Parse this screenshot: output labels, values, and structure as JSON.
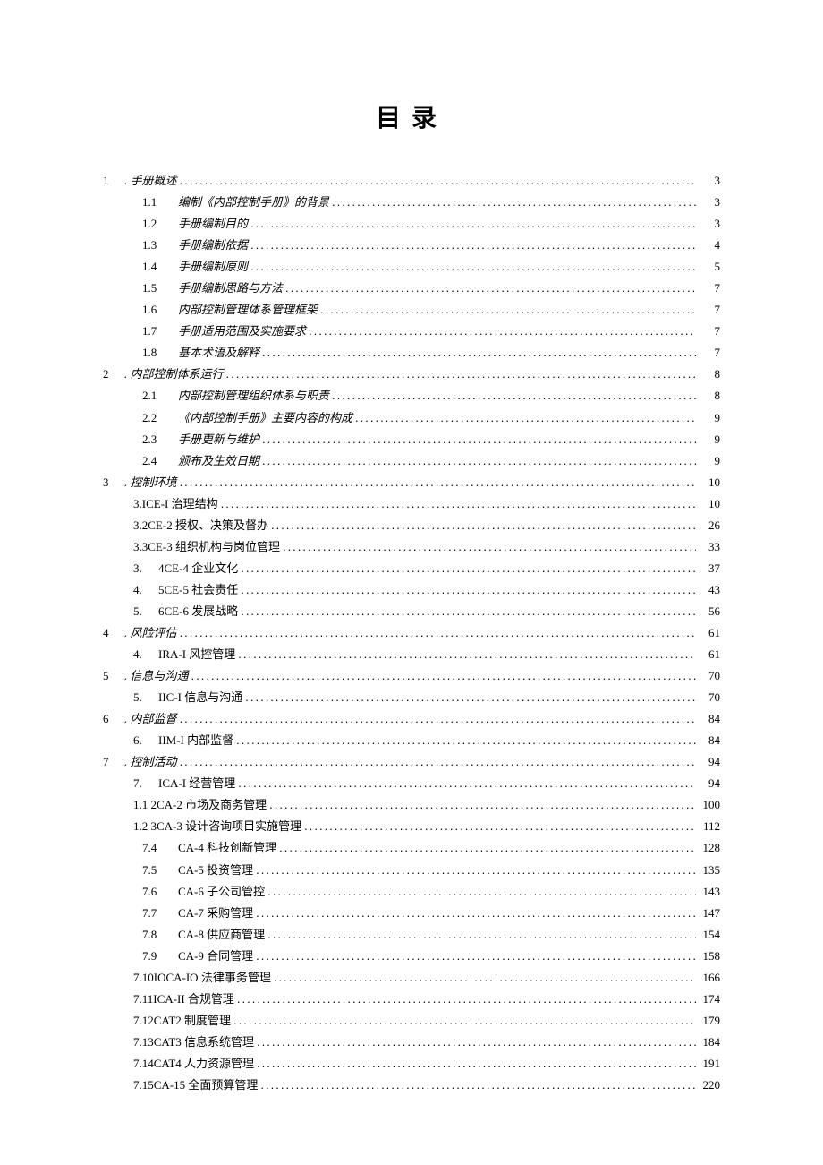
{
  "title": "目录",
  "entries": [
    {
      "level": 0,
      "num": "1",
      "sub": "",
      "text": ". 手册概述",
      "page": "3",
      "italic": true
    },
    {
      "level": 1,
      "num": "",
      "sub": "1.1",
      "text": "编制《内部控制手册》的背景",
      "page": "3",
      "italic": true
    },
    {
      "level": 1,
      "num": "",
      "sub": "1.2",
      "text": "手册编制目的",
      "page": "3",
      "italic": true
    },
    {
      "level": 1,
      "num": "",
      "sub": "1.3",
      "text": "手册编制依据",
      "page": "4",
      "italic": true
    },
    {
      "level": 1,
      "num": "",
      "sub": "1.4",
      "text": "手册编制原则",
      "page": "5",
      "italic": true
    },
    {
      "level": 1,
      "num": "",
      "sub": "1.5",
      "text": "手册编制思路与方法",
      "page": "7",
      "italic": true
    },
    {
      "level": 1,
      "num": "",
      "sub": "1.6",
      "text": "内部控制管理体系管理框架",
      "page": "7",
      "italic": true
    },
    {
      "level": 1,
      "num": "",
      "sub": "1.7",
      "text": "手册适用范围及实施要求",
      "page": "7",
      "italic": true
    },
    {
      "level": 1,
      "num": "",
      "sub": "1.8",
      "text": "基本术语及解释",
      "page": "7",
      "italic": true
    },
    {
      "level": 0,
      "num": "2",
      "sub": "",
      "text": ". 内部控制体系运行",
      "page": "8",
      "italic": true
    },
    {
      "level": 1,
      "num": "",
      "sub": "2.1",
      "text": "内部控制管理组织体系与职责",
      "page": "8",
      "italic": true
    },
    {
      "level": 1,
      "num": "",
      "sub": "2.2",
      "text": "《内部控制手册》主要内容的构成",
      "page": "9",
      "italic": true
    },
    {
      "level": 1,
      "num": "",
      "sub": "2.3",
      "text": "手册更新与维护",
      "page": "9",
      "italic": true
    },
    {
      "level": 1,
      "num": "",
      "sub": "2.4",
      "text": "颁布及生效日期",
      "page": "9",
      "italic": true
    },
    {
      "level": 0,
      "num": "3",
      "sub": "",
      "text": ". 控制环境",
      "page": "10",
      "italic": true
    },
    {
      "level": 2,
      "num": "",
      "sub": "",
      "text": "3.ICE-I 治理结构",
      "page": "10",
      "italic": false
    },
    {
      "level": 2,
      "num": "",
      "sub": "",
      "text": "3.2CE-2 授权、决策及督办",
      "page": "26",
      "italic": false
    },
    {
      "level": 2,
      "num": "",
      "sub": "",
      "text": "3.3CE-3 组织机构与岗位管理",
      "page": "33",
      "italic": false
    },
    {
      "level": 3,
      "num": "",
      "sub": "3.",
      "text": "4CE-4 企业文化",
      "page": "37",
      "italic": false
    },
    {
      "level": 3,
      "num": "",
      "sub": "4.",
      "text": "5CE-5 社会责任",
      "page": "43",
      "italic": false
    },
    {
      "level": 3,
      "num": "",
      "sub": "5.",
      "text": "6CE-6 发展战略",
      "page": "56",
      "italic": false
    },
    {
      "level": 0,
      "num": "4",
      "sub": "",
      "text": ". 风险评估",
      "page": "61",
      "italic": true
    },
    {
      "level": 3,
      "num": "",
      "sub": "4.",
      "text": "IRA-I 风控管理",
      "page": "61",
      "italic": false
    },
    {
      "level": 0,
      "num": "5",
      "sub": "",
      "text": ". 信息与沟通",
      "page": "70",
      "italic": true
    },
    {
      "level": 3,
      "num": "",
      "sub": "5.",
      "text": "IIC-I 信息与沟通",
      "page": "70",
      "italic": false
    },
    {
      "level": 0,
      "num": "6",
      "sub": "",
      "text": ". 内部监督",
      "page": "84",
      "italic": true
    },
    {
      "level": 3,
      "num": "",
      "sub": "6.",
      "text": "IIM-I 内部监督",
      "page": "84",
      "italic": false
    },
    {
      "level": 0,
      "num": "7",
      "sub": "",
      "text": ". 控制活动",
      "page": "94",
      "italic": true
    },
    {
      "level": 3,
      "num": "",
      "sub": "7.",
      "text": "ICA-I 经营管理",
      "page": "94",
      "italic": false
    },
    {
      "level": 2,
      "num": "",
      "sub": "",
      "text": "1.1 2CA-2 市场及商务管理",
      "page": "100",
      "italic": false
    },
    {
      "level": 2,
      "num": "",
      "sub": "",
      "text": "1.2 3CA-3 设计咨询项目实施管理",
      "page": "112",
      "italic": false
    },
    {
      "level": 1,
      "num": "",
      "sub": "7.4",
      "text": "CA-4 科技创新管理",
      "page": "128",
      "italic": false
    },
    {
      "level": 1,
      "num": "",
      "sub": "7.5",
      "text": "CA-5 投资管理",
      "page": "135",
      "italic": false
    },
    {
      "level": 1,
      "num": "",
      "sub": "7.6",
      "text": "CA-6 子公司管控",
      "page": "143",
      "italic": false
    },
    {
      "level": 1,
      "num": "",
      "sub": "7.7",
      "text": "CA-7 采购管理",
      "page": "147",
      "italic": false
    },
    {
      "level": 1,
      "num": "",
      "sub": "7.8",
      "text": "CA-8 供应商管理",
      "page": "154",
      "italic": false
    },
    {
      "level": 1,
      "num": "",
      "sub": "7.9",
      "text": "CA-9 合同管理",
      "page": "158",
      "italic": false
    },
    {
      "level": 2,
      "num": "",
      "sub": "",
      "text": "7.10IOCA-IO 法律事务管理",
      "page": "166",
      "italic": false
    },
    {
      "level": 2,
      "num": "",
      "sub": "",
      "text": "7.11ICA-II 合规管理",
      "page": "174",
      "italic": false
    },
    {
      "level": 2,
      "num": "",
      "sub": "",
      "text": "7.12CAT2 制度管理",
      "page": "179",
      "italic": false
    },
    {
      "level": 2,
      "num": "",
      "sub": "",
      "text": "7.13CAT3 信息系统管理",
      "page": "184",
      "italic": false
    },
    {
      "level": 2,
      "num": "",
      "sub": "",
      "text": "7.14CAT4 人力资源管理",
      "page": "191",
      "italic": false
    },
    {
      "level": 2,
      "num": "",
      "sub": "",
      "text": "7.15CA-15 全面预算管理",
      "page": "220",
      "italic": false
    }
  ]
}
